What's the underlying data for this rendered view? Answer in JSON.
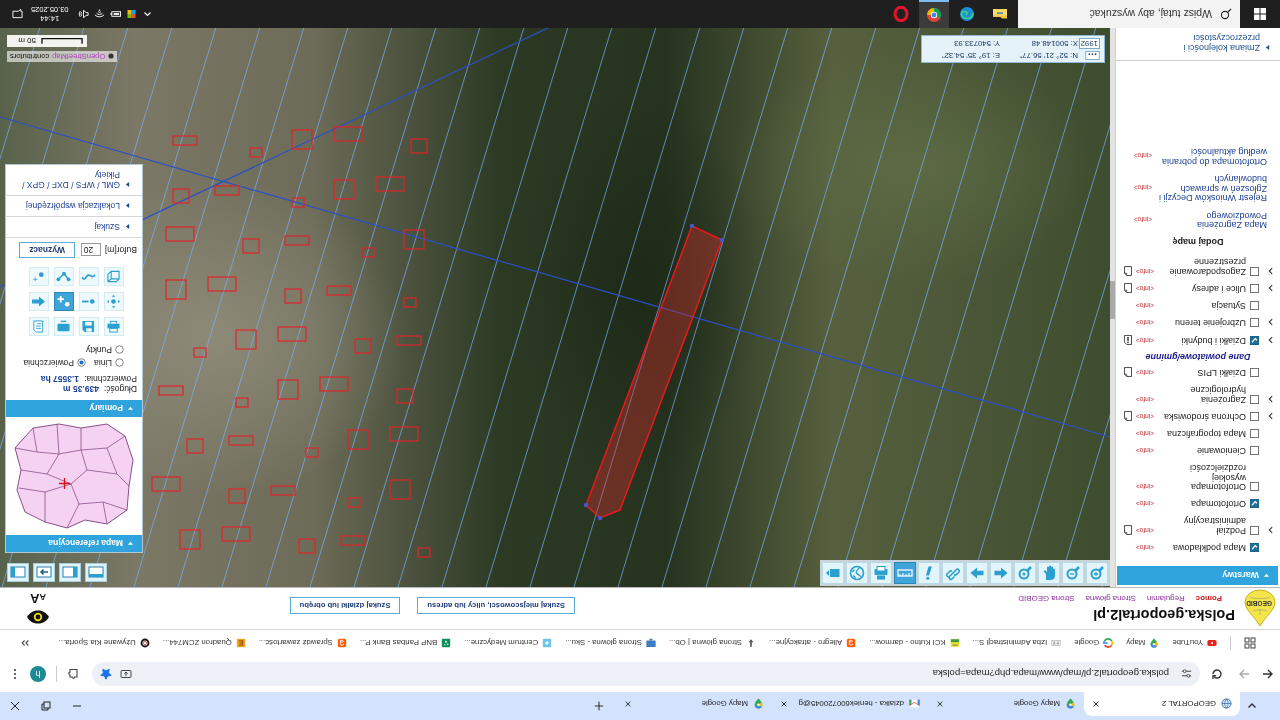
{
  "browser": {
    "tabs": [
      {
        "kind": "geoportal",
        "title": "GEOPORTAL 2",
        "selected": true
      },
      {
        "kind": "maps",
        "title": "Mapy Google",
        "selected": false
      },
      {
        "kind": "gmail",
        "title": "dzialka - heniek600720045@g",
        "selected": false
      },
      {
        "kind": "maps",
        "title": "Mapy Google",
        "selected": false
      }
    ],
    "url": "polska.geoportal2.pl/map/www/mapa.php?mapa=polska",
    "bookmarked": true,
    "profile_initial": "h",
    "bookmarks": [
      {
        "kind": "youtube",
        "label": "YouTube"
      },
      {
        "kind": "maps",
        "label": "Mapy"
      },
      {
        "kind": "google",
        "label": "Google"
      },
      {
        "kind": "kis",
        "label": "Izba Administracji S..."
      },
      {
        "kind": "kci",
        "label": "KCI Kutno - darmow..."
      },
      {
        "kind": "allegro",
        "label": "Allegro - atrakcyjne..."
      },
      {
        "kind": "arrow",
        "label": "Strona główna | Ob..."
      },
      {
        "kind": "monitor",
        "label": "Strona główna - Sku..."
      },
      {
        "kind": "medical",
        "label": "Centrum Medyczne..."
      },
      {
        "kind": "bnp",
        "label": "BNP Paribas Bank P..."
      },
      {
        "kind": "allegro",
        "label": "Sprawdź zawartość..."
      },
      {
        "kind": "quadron",
        "label": "Quadron ZCM744..."
      },
      {
        "kind": "ring",
        "label": "Używane Kia Sporta..."
      }
    ]
  },
  "site_header": {
    "logo_text": "GEOBID",
    "title": "Polska.geoportal2.pl",
    "links": [
      {
        "kind": "help",
        "label": "Pomoc"
      },
      {
        "kind": "page",
        "label": "Regulamin"
      },
      {
        "kind": "page",
        "label": "Strona główna"
      },
      {
        "kind": "page",
        "label": "Strona GEOBID"
      }
    ],
    "search_buttons": [
      "Szukaj miejscowości, ulicy lub adresu",
      "Szukaj działki lub obrębu"
    ],
    "text_size_button": "AA"
  },
  "layers_panel": {
    "title": "Warstwy",
    "expanded": true,
    "items": [
      {
        "kind": "layer",
        "label": "Mapa podkładowa",
        "checked": true,
        "expandable": false,
        "info": "<info>",
        "legend": false,
        "warning": false
      },
      {
        "kind": "layer",
        "label": "Podział administracyjny",
        "checked": false,
        "expandable": true,
        "info": "<info>",
        "legend": true,
        "warning": false
      },
      {
        "kind": "layer",
        "label": "Ortofotomapa",
        "checked": true,
        "expandable": false,
        "info": "<info>",
        "legend": false,
        "warning": false
      },
      {
        "kind": "layer",
        "label": "Ortofotomapa wysokiej rozdzielczości",
        "checked": false,
        "expandable": false,
        "info": "<info>",
        "legend": false,
        "warning": false
      },
      {
        "kind": "layer",
        "label": "Cieniowanie",
        "checked": false,
        "expandable": false,
        "info": "<info>",
        "legend": false,
        "warning": false
      },
      {
        "kind": "layer",
        "label": "Mapa topograficzna",
        "checked": false,
        "expandable": false,
        "info": "<info>",
        "legend": false,
        "warning": false
      },
      {
        "kind": "layer",
        "label": "Ochrona środowiska",
        "checked": false,
        "expandable": true,
        "info": "<info>",
        "legend": true,
        "warning": false
      },
      {
        "kind": "layer",
        "label": "Zagrożenia hydrologiczne",
        "checked": false,
        "expandable": true,
        "info": "<info>",
        "legend": false,
        "warning": false
      },
      {
        "kind": "layer",
        "label": "Działki LPIS",
        "checked": false,
        "expandable": false,
        "info": "<info>",
        "legend": true,
        "warning": false
      },
      {
        "kind": "section",
        "label": "Dane powiatowe/gminne"
      },
      {
        "kind": "layer",
        "label": "Działki i budynki",
        "checked": true,
        "expandable": true,
        "info": "<info>",
        "legend": true,
        "warning": true
      },
      {
        "kind": "layer",
        "label": "Uzbrojenie terenu",
        "checked": false,
        "expandable": true,
        "info": "<info>",
        "legend": false,
        "warning": false
      },
      {
        "kind": "layer",
        "label": "Sytuacja",
        "checked": false,
        "expandable": false,
        "info": "<info>",
        "legend": false,
        "warning": false
      },
      {
        "kind": "layer",
        "label": "Ulice i adresy",
        "checked": false,
        "expandable": true,
        "info": "<info>",
        "legend": true,
        "warning": false
      },
      {
        "kind": "layer",
        "label": "Zagospodarowanie przestrzenne",
        "checked": false,
        "expandable": true,
        "info": "<info>",
        "legend": true,
        "warning": false
      }
    ],
    "add_map_title": "Dodaj mapę",
    "add_maps": [
      {
        "label": "Mapa Zagrożenia Powodziowego",
        "info": "<info>"
      },
      {
        "label": "Rejestr Wniosków Decyzji i Zgłoszeń w sprawach budowlanych",
        "info": "<info>"
      },
      {
        "label": "Ortofotomapa do pobrania według aktualności",
        "info": "<info>"
      }
    ],
    "order_link": "Zmiana kolejności i przezroczystości"
  },
  "map": {
    "toolbar": [
      {
        "kind": "zoom-in",
        "selected": false
      },
      {
        "kind": "zoom-out",
        "selected": false
      },
      {
        "kind": "pan",
        "selected": false
      },
      {
        "kind": "zoom-window",
        "selected": false
      },
      {
        "kind": "back",
        "selected": false
      },
      {
        "kind": "forward",
        "selected": false
      },
      {
        "kind": "link",
        "selected": false
      },
      {
        "kind": "info",
        "selected": false
      },
      {
        "kind": "measure",
        "selected": true
      },
      {
        "kind": "print",
        "selected": false
      },
      {
        "kind": "globe",
        "selected": false
      },
      {
        "kind": "panel",
        "selected": false
      }
    ],
    "panel_buttons": [
      {
        "kind": "maximize"
      },
      {
        "kind": "dock"
      },
      {
        "kind": "collapse"
      },
      {
        "kind": "sidebar"
      }
    ],
    "reference_map": {
      "title": "Mapa referencyjna",
      "expanded": true
    },
    "measurements": {
      "title": "Pomiary",
      "expanded": true,
      "length_label": "Długość:",
      "length": "439.35 m",
      "area_label": "Powierzchnia:",
      "area": "1.3557 ha",
      "modes": [
        {
          "label": "Linia",
          "selected": false
        },
        {
          "label": "Powierzchnia",
          "selected": true
        },
        {
          "label": "Punkty",
          "selected": false
        }
      ],
      "tools": [
        {
          "kind": "print",
          "selected": false
        },
        {
          "kind": "save",
          "selected": false
        },
        {
          "kind": "screen",
          "selected": false
        },
        {
          "kind": "report",
          "selected": false
        },
        {
          "kind": "move",
          "selected": false
        },
        {
          "kind": "remove-point",
          "selected": false
        },
        {
          "kind": "add-point",
          "selected": true
        },
        {
          "kind": "back",
          "selected": false
        },
        {
          "kind": "area",
          "selected": false
        },
        {
          "kind": "curve",
          "selected": false
        },
        {
          "kind": "polyline",
          "selected": false
        },
        {
          "kind": "point",
          "selected": false
        }
      ],
      "buffer_label": "Bufor[m]",
      "buffer_value": "20",
      "buffer_button": "Wyznacz"
    },
    "sections": [
      {
        "label": "Szukaj",
        "expanded": false
      },
      {
        "label": "Lokalizacja współrzędnej",
        "expanded": false
      },
      {
        "label": "GML / WFS / DXF / GPX / Pikiety",
        "expanded": false
      }
    ],
    "coordinates": {
      "geo": [
        "N: 52° 21' 56.77\"",
        "E: 19° 35' 54.32\""
      ],
      "system": "1992",
      "planar": [
        "X: 500148.48",
        "Y: 540733.93"
      ]
    },
    "attribution_link": "OpenStreetMap",
    "attribution": "contributors",
    "scale": "50 m"
  },
  "taskbar": {
    "search_placeholder": "Wpisz tutaj, aby wyszukać",
    "apps": [
      {
        "kind": "explorer",
        "selected": false
      },
      {
        "kind": "edge",
        "selected": false
      },
      {
        "kind": "chrome",
        "selected": true
      },
      {
        "kind": "opera",
        "selected": false
      }
    ],
    "time": "14:44",
    "date": "03.05.2025"
  }
}
